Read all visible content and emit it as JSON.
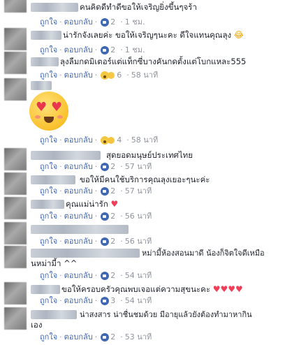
{
  "actions": {
    "like": "ถูกใจ",
    "reply": "ตอบกลับ",
    "dot": "·"
  },
  "comments": [
    {
      "text": "คนคิดดีทำดีขอให้เจริญยิ่งขึ้นๆจร้า",
      "reactions": "2",
      "time": "1 ชม."
    },
    {
      "text": "น่ารักจังเลยค่ะ ขอให้เจริญๆนะคะ ดีใจแทนคุณลุง",
      "trailing_emoji": "😂",
      "reactions": "2",
      "time": "1 ชม."
    },
    {
      "text": "ลุงลืมกดมิเตอร์แต่แท็กซี่บางคันกดตั้งแต่โบกแหละ555",
      "reactions": "6",
      "time": "58 นาที"
    },
    {
      "text": "",
      "sticker": "heart-eyes",
      "reactions": "4",
      "time": "58 นาที"
    },
    {
      "text": "สุดยอดมนุษย์ประเทศไทย",
      "reactions": "2",
      "time": "57 นาที"
    },
    {
      "text": "ขอให้มีคนใช้บริการคุณลุงเยอะๆนะค่ะ",
      "reactions": "2",
      "time": "57 นาที"
    },
    {
      "text": "คุณแม่น่ารัก",
      "trailing_emoji": "♥",
      "reactions": "2",
      "time": "56 นาที"
    },
    {
      "text": "",
      "reactions": "2",
      "time": "56 นาที"
    },
    {
      "text": "หม่ามี้ห้องสอนมาดี น้องก็จิตใจดีเหมือ",
      "text2": "นหม่ามี้า ^^",
      "reactions": "2",
      "time": "54 นาที"
    },
    {
      "text": "ขอให้ครอบครัวคุณพบเจอแต่ความสุขนะคะ",
      "trailing_emoji": "♥♥♥♥",
      "reactions": "3",
      "time": "54 นาที"
    },
    {
      "text": "น่าสงสาร น่าชื่นชมด้วย มีอายุแล้วยังต้องทำมาหากิน",
      "text2": "เอง",
      "reactions": "2",
      "time": "53 นาที"
    }
  ]
}
